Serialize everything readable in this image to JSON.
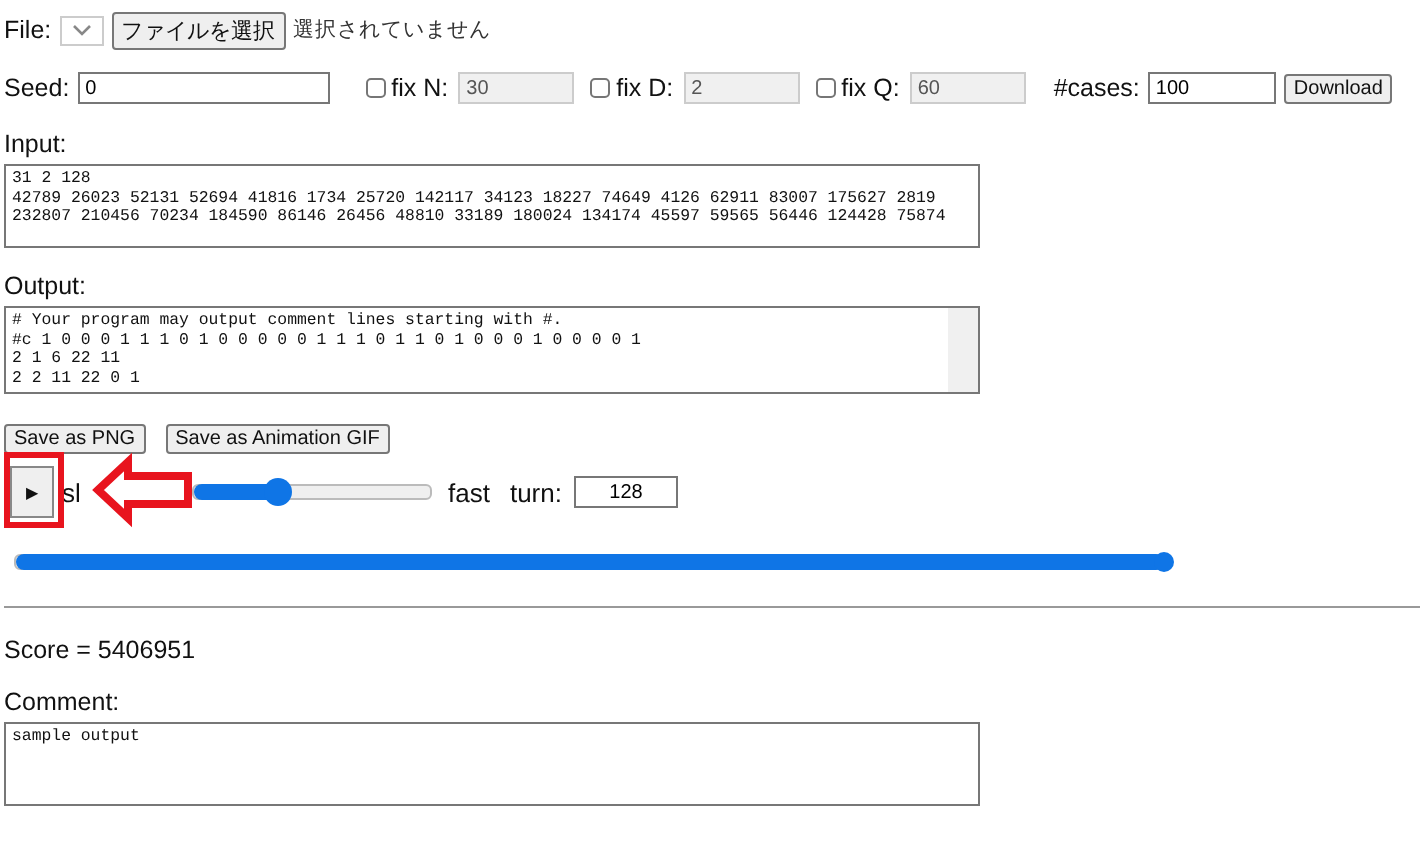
{
  "file": {
    "label": "File:",
    "button": "ファイルを選択",
    "status": "選択されていません"
  },
  "seed": {
    "label": "Seed:",
    "value": "0"
  },
  "fixes": [
    {
      "label": "fix N:",
      "checked": false,
      "value": "30"
    },
    {
      "label": "fix D:",
      "checked": false,
      "value": "2"
    },
    {
      "label": "fix Q:",
      "checked": false,
      "value": "60"
    }
  ],
  "cases": {
    "label": "#cases:",
    "value": "100"
  },
  "download": "Download",
  "input": {
    "label": "Input:",
    "lines": [
      "31 2 128",
      "42789 26023 52131 52694 41816 1734 25720 142117 34123 18227 74649 4126 62911 83007 175627 2819",
      "232807 210456 70234 184590 86146 26456 48810 33189 180024 134174 45597 59565 56446 124428 75874"
    ]
  },
  "output": {
    "label": "Output:",
    "lines": [
      "# Your program may output comment lines starting with #.",
      "#c 1 0 0 0 1 1 1 0 1 0 0 0 0 0 1 1 1 0 1 1 0 1 0 0 0 1 0 0 0 0 1",
      "2 1 6 22 11",
      "2 2 11 22 0 1"
    ]
  },
  "save_buttons": [
    "Save as PNG",
    "Save as Animation GIF"
  ],
  "play": {
    "icon": "▶",
    "slow_label": "sl",
    "speed": {
      "level": 0.36
    },
    "fast_label": "fast",
    "turn_label": "turn:",
    "turn_value": "128"
  },
  "turn_slider": {
    "level": 1.0
  },
  "score": "Score = 5406951",
  "comment": {
    "label": "Comment:",
    "value": "sample output"
  }
}
